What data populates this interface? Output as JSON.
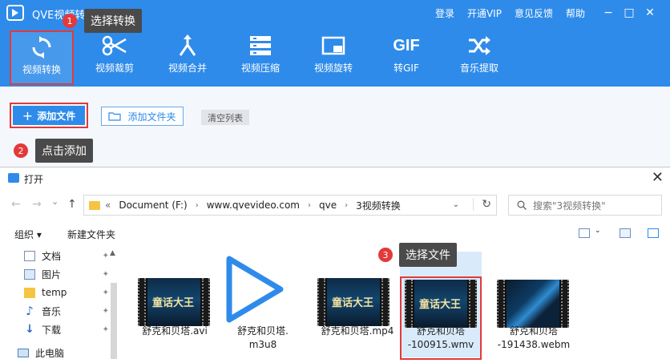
{
  "app": {
    "title": "QVE视频转换器",
    "top_menu": [
      "登录",
      "开通VIP",
      "意见反馈",
      "帮助"
    ],
    "window_controls": [
      "−",
      "□",
      "✕"
    ],
    "tools": [
      {
        "label": "视频转换",
        "icon": "refresh-icon",
        "active": true
      },
      {
        "label": "视频裁剪",
        "icon": "scissors-icon"
      },
      {
        "label": "视频合并",
        "icon": "merge-icon"
      },
      {
        "label": "视频压缩",
        "icon": "compress-icon"
      },
      {
        "label": "视频旋转",
        "icon": "rotate-icon"
      },
      {
        "label": "转GIF",
        "icon": "gif-icon"
      },
      {
        "label": "音乐提取",
        "icon": "shuffle-icon"
      }
    ],
    "gif_icon_text": "GIF",
    "actions": {
      "add_file": "添加文件",
      "add_folder": "添加文件夹",
      "clear_list": "清空列表"
    },
    "accent_color": "#2e8bea",
    "highlight_color": "#e23a3a"
  },
  "callouts": [
    {
      "num": "1",
      "text": "选择转换"
    },
    {
      "num": "2",
      "text": "点击添加"
    },
    {
      "num": "3",
      "text": "选择文件"
    }
  ],
  "dialog": {
    "title": "打开",
    "close": "✕",
    "nav": {
      "back": "←",
      "forward": "→",
      "recent": "⌄",
      "up": "↑"
    },
    "address": {
      "prefix": "«",
      "segments": [
        "Document (F:)",
        "www.qvevideo.com",
        "qve",
        "3视频转换"
      ],
      "separator": "›"
    },
    "refresh": "↻",
    "search_placeholder": "搜索\"3视频转换\"",
    "commands": {
      "organize": "组织 ▾",
      "new_folder": "新建文件夹"
    },
    "sidebar": [
      {
        "label": "文档",
        "icon": "document-icon"
      },
      {
        "label": "图片",
        "icon": "picture-icon"
      },
      {
        "label": "temp",
        "icon": "folder-icon"
      },
      {
        "label": "音乐",
        "icon": "music-icon"
      },
      {
        "label": "下载",
        "icon": "download-icon"
      },
      {
        "label": "此电脑",
        "icon": "computer-icon"
      }
    ],
    "files": [
      {
        "name_lines": [
          "舒克和贝塔.avi"
        ],
        "thumb_text": "童话大王"
      },
      {
        "name_lines": [
          "舒克和贝塔.",
          "m3u8"
        ],
        "thumb_text": ""
      },
      {
        "name_lines": [
          "舒克和贝塔.mp4"
        ],
        "thumb_text": "童话大王"
      },
      {
        "name_lines": [
          "舒克和贝塔",
          "-100915.wmv"
        ],
        "thumb_text": "童话大王",
        "selected": true
      },
      {
        "name_lines": [
          "舒克和贝塔",
          "-191438.webm"
        ],
        "thumb_text": ""
      }
    ]
  }
}
